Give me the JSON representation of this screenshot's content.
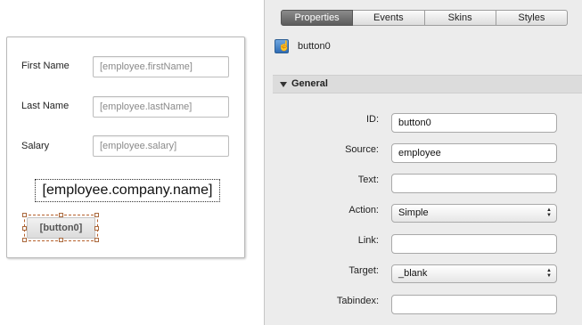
{
  "form": {
    "fields": [
      {
        "label": "First Name",
        "value": "[employee.firstName]"
      },
      {
        "label": "Last Name",
        "value": "[employee.lastName]"
      },
      {
        "label": "Salary",
        "value": "[employee.salary]"
      }
    ],
    "company_label": "[employee.company.name]",
    "selected_button": "[button0]"
  },
  "panel": {
    "tabs": [
      "Properties",
      "Events",
      "Skins",
      "Styles"
    ],
    "active_tab": "Properties",
    "component": {
      "name": "button0",
      "icon": "button-component-icon"
    },
    "section": "General",
    "properties": [
      {
        "label": "ID:",
        "value": "button0",
        "kind": "text"
      },
      {
        "label": "Source:",
        "value": "employee",
        "kind": "text"
      },
      {
        "label": "Text:",
        "value": "",
        "kind": "text"
      },
      {
        "label": "Action:",
        "value": "Simple",
        "kind": "select"
      },
      {
        "label": "Link:",
        "value": "",
        "kind": "text"
      },
      {
        "label": "Target:",
        "value": "_blank",
        "kind": "select"
      },
      {
        "label": "Tabindex:",
        "value": "",
        "kind": "text"
      }
    ]
  },
  "colors": {
    "active_tab": "#6e6e6e",
    "selection_handle": "#a9683c",
    "panel_bg": "#ececec"
  }
}
